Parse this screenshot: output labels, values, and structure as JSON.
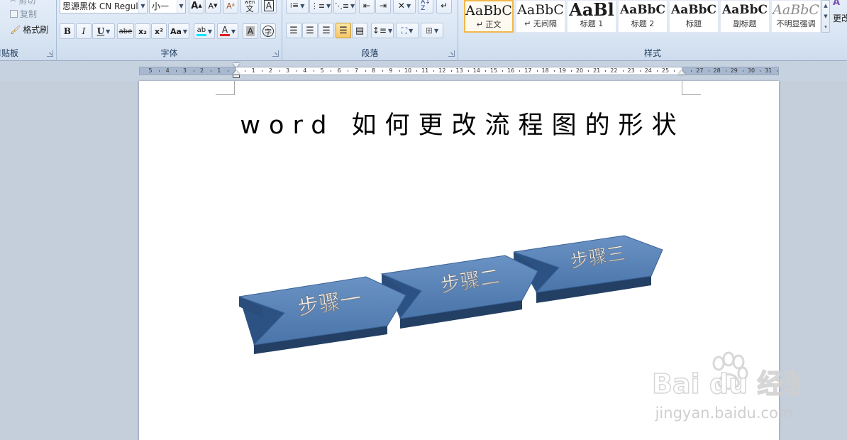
{
  "ribbon": {
    "clipboard": {
      "cut_label": "剪切",
      "copy_label": "复制",
      "format_painter_label": "格式刷",
      "group_label": "剪贴板"
    },
    "font": {
      "font_name": "思源黑体 CN Regul",
      "font_size": "小一",
      "grow_label": "A",
      "shrink_label": "A",
      "pinyin_label": "wén",
      "pinyin_char": "文",
      "border_char_label": "A",
      "bold_label": "B",
      "italic_label": "I",
      "underline_label": "U",
      "strike_label": "abe",
      "subscript_label": "x₂",
      "superscript_label": "x²",
      "case_label": "Aa",
      "highlight_label": "ab",
      "font_color_label": "A",
      "shade_label": "A",
      "enclose_label": "字",
      "group_label": "字体"
    },
    "paragraph": {
      "group_label": "段落"
    },
    "styles": {
      "group_label": "样式",
      "more_label": "更改",
      "tiles": [
        {
          "preview": "AaBbC",
          "name": "↵ 正文"
        },
        {
          "preview": "AaBbC",
          "name": "↵ 无间隔"
        },
        {
          "preview": "AaBl",
          "name": "标题 1"
        },
        {
          "preview": "AaBbC",
          "name": "标题 2"
        },
        {
          "preview": "AaBbC",
          "name": "标题"
        },
        {
          "preview": "AaBbC",
          "name": "副标题"
        },
        {
          "preview": "AaBbC",
          "name": "不明显强调"
        }
      ]
    }
  },
  "ruler": {
    "left_numbers": [
      "5",
      "4",
      "3",
      "2",
      "1"
    ],
    "right_numbers": [
      "1",
      "2",
      "3",
      "4",
      "5",
      "6",
      "7",
      "8",
      "9",
      "10",
      "11",
      "12",
      "13",
      "14",
      "15",
      "16",
      "17",
      "18",
      "19",
      "20",
      "21",
      "22",
      "23",
      "24",
      "25",
      "27",
      "28",
      "29",
      "30",
      "31"
    ]
  },
  "document": {
    "title": "word  如何更改流程图的形状",
    "steps": [
      "步骤一",
      "步骤二",
      "步骤三"
    ]
  },
  "watermark": {
    "brand": "Bai du 经验",
    "url": "jingyan.baidu.com"
  },
  "colors": {
    "shape_top": "#5782b8",
    "shape_side": "#2e5586",
    "shape_dark": "#233f63",
    "ribbon_bg": "#dae6f4",
    "doc_bg": "#c5cfdc",
    "selected_style_border": "#f1b94a"
  }
}
